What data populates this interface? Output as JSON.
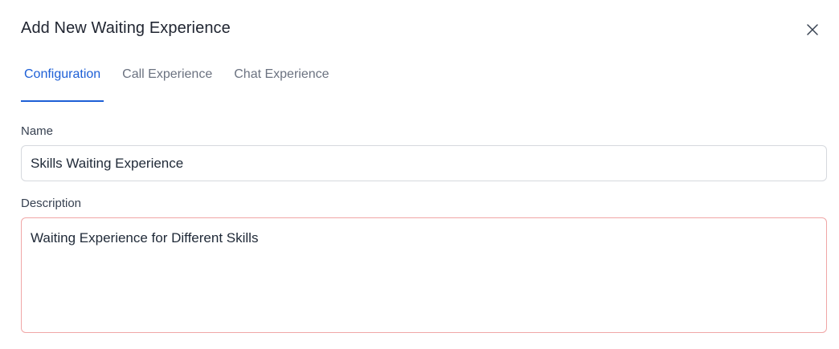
{
  "dialog": {
    "title": "Add New Waiting Experience",
    "close_icon": "close-icon"
  },
  "tabs": [
    {
      "label": "Configuration",
      "active": true
    },
    {
      "label": "Call Experience",
      "active": false
    },
    {
      "label": "Chat Experience",
      "active": false
    }
  ],
  "form": {
    "name_label": "Name",
    "name_value": "Skills Waiting Experience",
    "description_label": "Description",
    "description_value": "Waiting Experience for Different Skills"
  },
  "colors": {
    "accent": "#1d5fd6",
    "error_border": "#f0a6a6",
    "input_border": "#d6d9de"
  }
}
